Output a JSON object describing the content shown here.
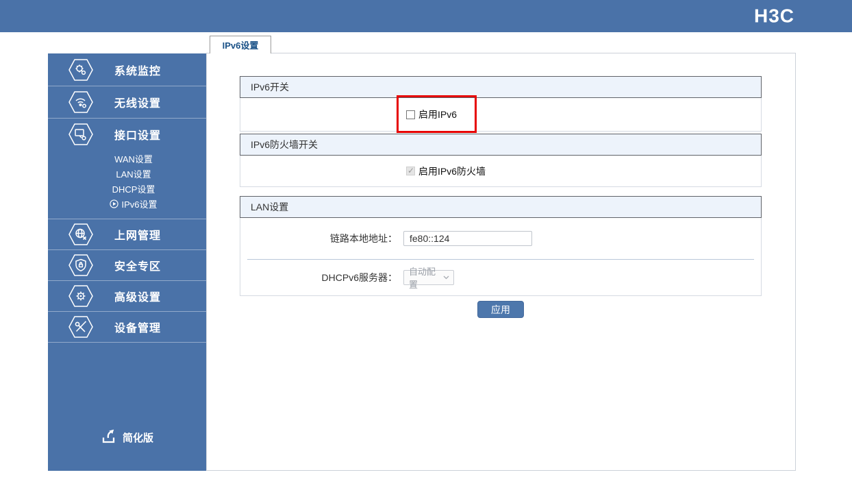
{
  "header": {
    "logo": "H3C"
  },
  "tab": {
    "label": "IPv6设置"
  },
  "sidebar": {
    "items": [
      {
        "label": "系统监控"
      },
      {
        "label": "无线设置"
      },
      {
        "label": "接口设置"
      },
      {
        "label": "上网管理"
      },
      {
        "label": "安全专区"
      },
      {
        "label": "高级设置"
      },
      {
        "label": "设备管理"
      }
    ],
    "submenu": {
      "items": [
        "WAN设置",
        "LAN设置",
        "DHCP设置",
        "IPv6设置"
      ],
      "active": "IPv6设置"
    },
    "footer": {
      "label": "简化版"
    }
  },
  "main": {
    "sections": {
      "ipv6_switch": {
        "title": "IPv6开关",
        "checkbox_label": "启用IPv6",
        "checked": false,
        "highlighted": true
      },
      "ipv6_firewall": {
        "title": "IPv6防火墙开关",
        "checkbox_label": "启用IPv6防火墙",
        "checked": true,
        "disabled": true
      },
      "lan": {
        "title": "LAN设置",
        "link_local_label": "链路本地地址：",
        "link_local_value": "fe80::124",
        "dhcpv6_label": "DHCPv6服务器：",
        "dhcpv6_value": "自动配置"
      }
    },
    "apply_label": "应用"
  },
  "colors": {
    "primary_blue": "#4a72a8",
    "highlight_red": "#e60000",
    "section_header_bg": "#edf3fb",
    "tab_text": "#1a5187",
    "apply_button_bg": "#4d77ac"
  }
}
